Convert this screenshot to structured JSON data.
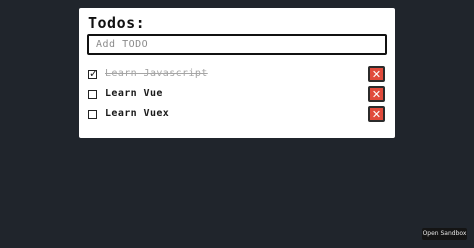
{
  "app": {
    "title": "Todos:"
  },
  "input": {
    "placeholder": "Add TODO",
    "value": ""
  },
  "todos": [
    {
      "text": "Learn Javascript",
      "completed": true
    },
    {
      "text": "Learn Vue",
      "completed": false
    },
    {
      "text": "Learn Vuex",
      "completed": false
    }
  ],
  "icons": {
    "checked": "check-icon",
    "delete": "close-icon"
  },
  "colors": {
    "background": "#20252c",
    "card": "#ffffff",
    "delete_button": "#e14b3c",
    "completed_text": "#a5a5a5"
  },
  "footer": {
    "open_sandbox_label": "Open Sandbox"
  }
}
